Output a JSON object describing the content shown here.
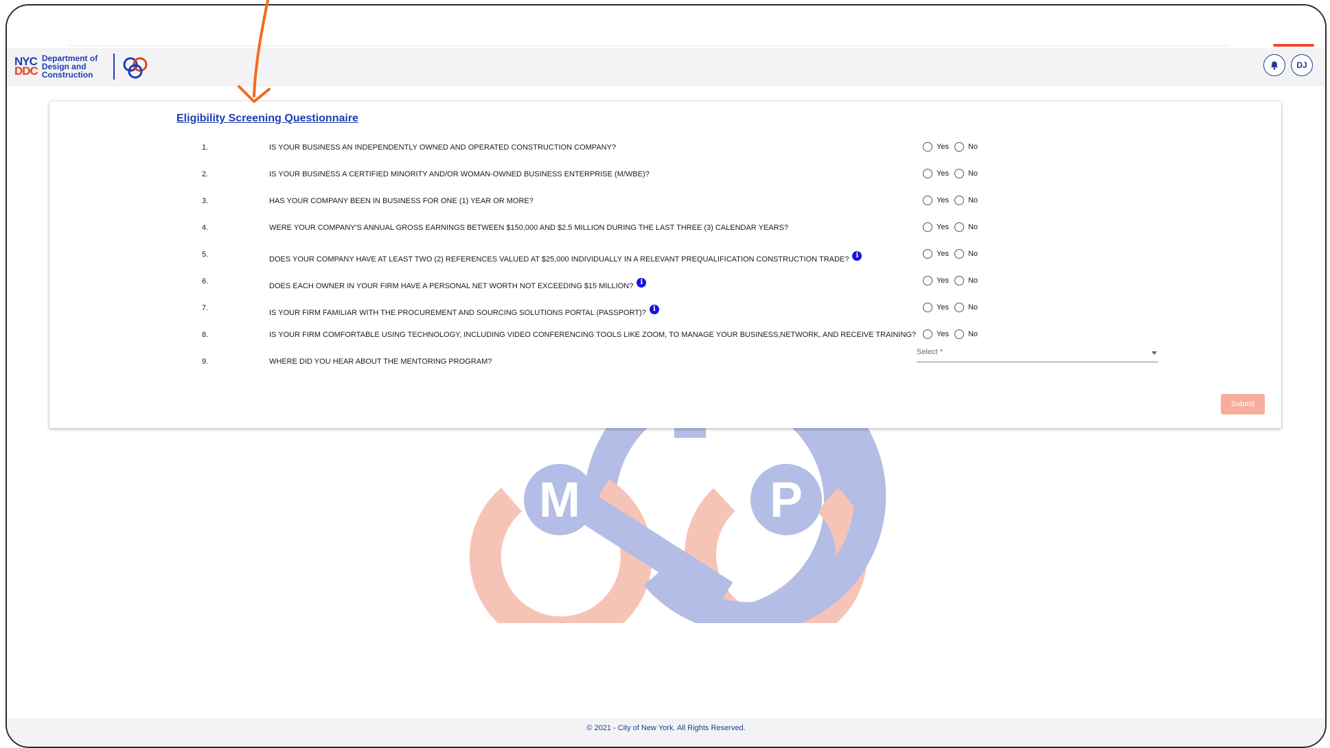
{
  "header": {
    "logo_line1": "NYC",
    "logo_line2": "DDC",
    "department": "Department of Design and Construction",
    "user_initials": "DJ",
    "notification_icon": "bell-icon"
  },
  "form": {
    "title": "Eligibility Screening Questionnaire",
    "yes_label": "Yes",
    "no_label": "No",
    "questions": [
      {
        "num": "1.",
        "text": "IS YOUR BUSINESS AN INDEPENDENTLY OWNED AND OPERATED CONSTRUCTION COMPANY?"
      },
      {
        "num": "2.",
        "text": "IS YOUR BUSINESS A CERTIFIED MINORITY AND/OR WOMAN-OWNED BUSINESS ENTERPRISE (M/WBE)?"
      },
      {
        "num": "3.",
        "text": "HAS YOUR COMPANY BEEN IN BUSINESS FOR ONE (1) YEAR OR MORE?"
      },
      {
        "num": "4.",
        "text": "WERE YOUR COMPANY'S ANNUAL GROSS EARNINGS BETWEEN $150,000 AND $2.5 MILLION DURING THE LAST THREE (3) CALENDAR YEARS?"
      },
      {
        "num": "5.",
        "text": "DOES YOUR COMPANY HAVE AT LEAST TWO (2) REFERENCES VALUED AT $25,000 INDIVIDUALLY IN A RELEVANT PREQUALIFICATION CONSTRUCTION TRADE?"
      },
      {
        "num": "6.",
        "text": "DOES EACH OWNER IN YOUR FIRM HAVE A PERSONAL NET WORTH NOT EXCEEDING $15 MILLION?"
      },
      {
        "num": "7.",
        "text": "IS YOUR FIRM FAMILIAR WITH THE PROCUREMENT AND SOURCING SOLUTIONS PORTAL (PASSPORT)?"
      },
      {
        "num": "8.",
        "text": "IS YOUR FIRM COMFORTABLE USING TECHNOLOGY, INCLUDING VIDEO CONFERENCING TOOLS LIKE ZOOM, TO MANAGE YOUR BUSINESS,NETWORK, AND RECEIVE TRAINING?"
      },
      {
        "num": "9.",
        "text": "WHERE DID YOU HEAR ABOUT THE MENTORING PROGRAM?"
      }
    ],
    "info_glyph": "i",
    "select_placeholder": "Select *",
    "submit_label": "Submit"
  },
  "watermark": {
    "left_letter": "M",
    "right_letter": "P"
  },
  "footer": {
    "text": "© 2021 - City of New York. All Rights Reserved."
  },
  "colors": {
    "brand_blue": "#1e3cb4",
    "brand_red": "#e0451e",
    "submit_disabled": "#f7ad9c",
    "annotation": "#f26b1d"
  }
}
